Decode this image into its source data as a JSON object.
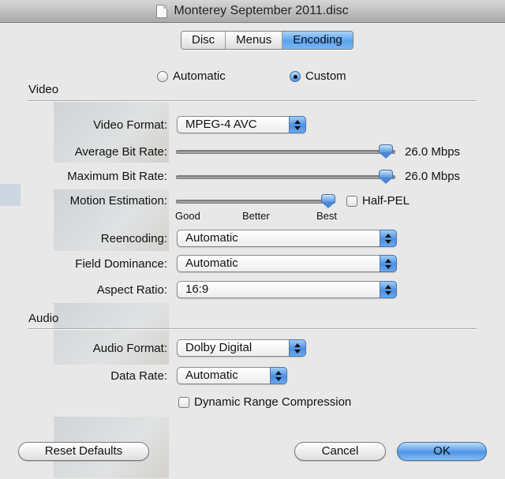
{
  "window": {
    "title": "Monterey September 2011.disc"
  },
  "tabs": [
    {
      "label": "Disc",
      "active": false
    },
    {
      "label": "Menus",
      "active": false
    },
    {
      "label": "Encoding",
      "active": true
    }
  ],
  "mode": {
    "automatic_label": "Automatic",
    "custom_label": "Custom",
    "selected": "Custom"
  },
  "video": {
    "title": "Video",
    "format": {
      "label": "Video Format:",
      "value": "MPEG-4 AVC"
    },
    "avg_bitrate": {
      "label": "Average Bit Rate:",
      "value_text": "26.0 Mbps",
      "fraction": 0.99
    },
    "max_bitrate": {
      "label": "Maximum Bit Rate:",
      "value_text": "26.0 Mbps",
      "fraction": 0.99
    },
    "motion": {
      "label": "Motion Estimation:",
      "fraction": 1.0,
      "ticks": [
        "Good",
        "Better",
        "Best"
      ],
      "halfpel_label": "Half-PEL",
      "halfpel_checked": false
    },
    "reencoding": {
      "label": "Reencoding:",
      "value": "Automatic"
    },
    "field_dominance": {
      "label": "Field Dominance:",
      "value": "Automatic"
    },
    "aspect_ratio": {
      "label": "Aspect Ratio:",
      "value": "16:9"
    }
  },
  "audio": {
    "title": "Audio",
    "format": {
      "label": "Audio Format:",
      "value": "Dolby Digital"
    },
    "data_rate": {
      "label": "Data Rate:",
      "value": "Automatic"
    },
    "drc": {
      "label": "Dynamic Range Compression",
      "checked": false
    }
  },
  "buttons": {
    "reset": "Reset Defaults",
    "cancel": "Cancel",
    "ok": "OK"
  },
  "colors": {
    "accent": "#4f95e6",
    "window_bg": "#e8e8e8"
  }
}
